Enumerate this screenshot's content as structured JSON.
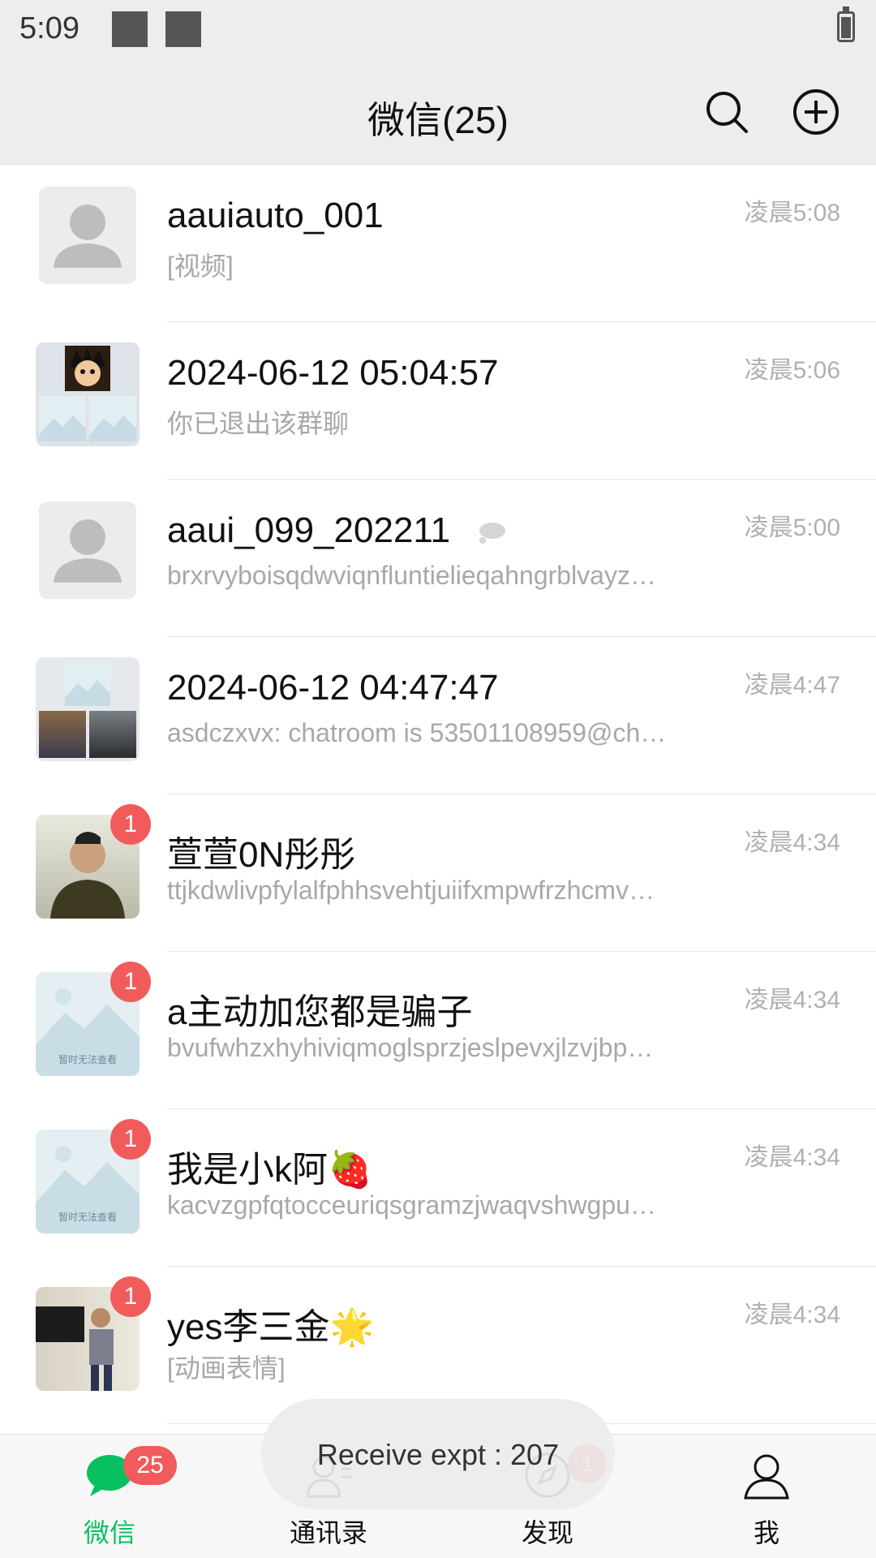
{
  "status_bar": {
    "time": "5:09"
  },
  "header": {
    "title": "微信(25)"
  },
  "chats": [
    {
      "title": "aauiauto_001",
      "preview": "[视频]",
      "time": "凌晨5:08",
      "badge": ""
    },
    {
      "title": "2024-06-12 05:04:57",
      "preview": "你已退出该群聊",
      "time": "凌晨5:06",
      "badge": ""
    },
    {
      "title": "aaui_099_202211",
      "preview": "brxrvyboisqdwviqnfluntielieqahngrblvayz…",
      "time": "凌晨5:00",
      "badge": ""
    },
    {
      "title": "2024-06-12 04:47:47",
      "preview": "asdczxvx: chatroom is 53501108959@ch…",
      "time": "凌晨4:47",
      "badge": ""
    },
    {
      "title": "萱萱0N彤彤",
      "preview": "ttjkdwlivpfylalfphhsvehtjuiifxmpwfrzhcmv…",
      "time": "凌晨4:34",
      "badge": "1"
    },
    {
      "title": "a主动加您都是骗子",
      "preview": "bvufwhzxhyhiviqmoglsprzjeslpevxjlzvjbp…",
      "time": "凌晨4:34",
      "badge": "1"
    },
    {
      "title": "我是小k阿🍓",
      "preview": "kacvzgpfqtocceuriqsgramzjwaqvshwgpu…",
      "time": "凌晨4:34",
      "badge": "1"
    },
    {
      "title": "yes李三金🌟",
      "preview": "[动画表情]",
      "time": "凌晨4:34",
      "badge": "1"
    }
  ],
  "placeholder_text": "暂时无法查看",
  "tabbar": {
    "tabs": [
      {
        "label": "微信",
        "badge": "25"
      },
      {
        "label": "通讯录"
      },
      {
        "label": "发现",
        "badge": "1"
      },
      {
        "label": "我"
      }
    ]
  },
  "toast": {
    "text": "Receive expt : 207"
  },
  "colors": {
    "accent": "#07c160",
    "badge": "#f25b5b",
    "header_bg": "#ededed"
  }
}
